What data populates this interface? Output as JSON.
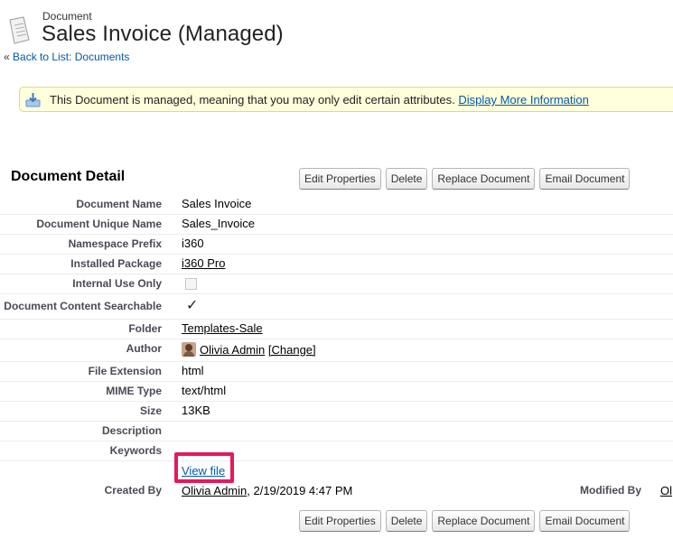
{
  "header": {
    "breadcrumb": "Document",
    "title": "Sales Invoice (Managed)",
    "back_prefix": "«",
    "back_link": "Back to List: Documents"
  },
  "notice": {
    "text": "This Document is managed, meaning that you may only edit certain attributes.",
    "link": "Display More Information"
  },
  "detail": {
    "section_title": "Document Detail",
    "buttons": [
      "Edit Properties",
      "Delete",
      "Replace Document",
      "Email Document"
    ],
    "fields": [
      {
        "label": "Document Name",
        "value": "Sales Invoice"
      },
      {
        "label": "Document Unique Name",
        "value": "Sales_Invoice"
      },
      {
        "label": "Namespace Prefix",
        "value": "i360"
      },
      {
        "label": "Installed Package",
        "value": "i360 Pro"
      },
      {
        "label": "Internal Use Only",
        "value": ""
      },
      {
        "label": "Document Content Searchable",
        "value": "✓"
      },
      {
        "label": "Folder",
        "value": "Templates-Sale"
      },
      {
        "label": "Author",
        "value": "Olivia Admin",
        "extra": "[Change]"
      },
      {
        "label": "File Extension",
        "value": "html"
      },
      {
        "label": "MIME Type",
        "value": "text/html"
      },
      {
        "label": "Size",
        "value": "13KB"
      },
      {
        "label": "Description",
        "value": ""
      },
      {
        "label": "Keywords",
        "value": ""
      }
    ],
    "view_file": "View file",
    "created_by_label": "Created By",
    "created_by_user": "Olivia Admin",
    "created_by_date": ", 2/19/2019 4:47 PM",
    "modified_by_label": "Modified By",
    "modified_by_user": "Ol"
  }
}
